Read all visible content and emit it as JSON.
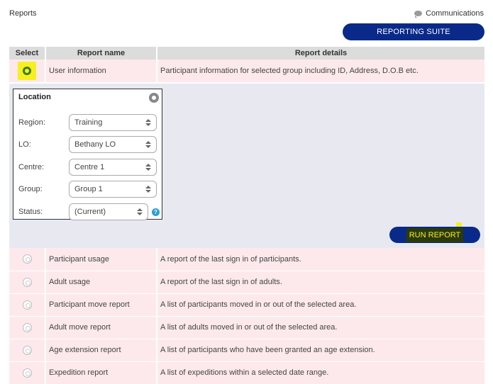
{
  "header": {
    "title": "Reports",
    "communications_label": "Communications",
    "reporting_suite_label": "REPORTING SUITE"
  },
  "table": {
    "columns": [
      "Select",
      "Report name",
      "Report details"
    ],
    "selected_report": {
      "name": "User information",
      "details": "Participant information for selected group including ID, Address, D.O.B etc."
    },
    "other_reports": [
      {
        "name": "Participant usage",
        "details": "A report of the last sign in of participants."
      },
      {
        "name": "Adult usage",
        "details": "A report of the last sign in of adults."
      },
      {
        "name": "Participant move report",
        "details": "A list of participants moved in or out of the selected area."
      },
      {
        "name": "Adult move report",
        "details": "A list of adults moved in or out of the selected area."
      },
      {
        "name": "Age extension report",
        "details": "A list of participants who have been granted an age extension."
      },
      {
        "name": "Expedition report",
        "details": "A list of expeditions within a selected date range."
      }
    ]
  },
  "location": {
    "title": "Location",
    "fields": [
      {
        "label": "Region:",
        "value": "Training"
      },
      {
        "label": "LO:",
        "value": "Bethany LO"
      },
      {
        "label": "Centre:",
        "value": "Centre 1"
      },
      {
        "label": "Group:",
        "value": "Group 1"
      },
      {
        "label": "Status:",
        "value": "(Current)"
      }
    ],
    "help_glyph": "?"
  },
  "run_report_label": "RUN REPORT",
  "colors": {
    "primary_button": "#0a2a8a",
    "row_background": "#fde9ec",
    "panel_background": "#e8e9f0",
    "highlight": "#f7ef22"
  }
}
